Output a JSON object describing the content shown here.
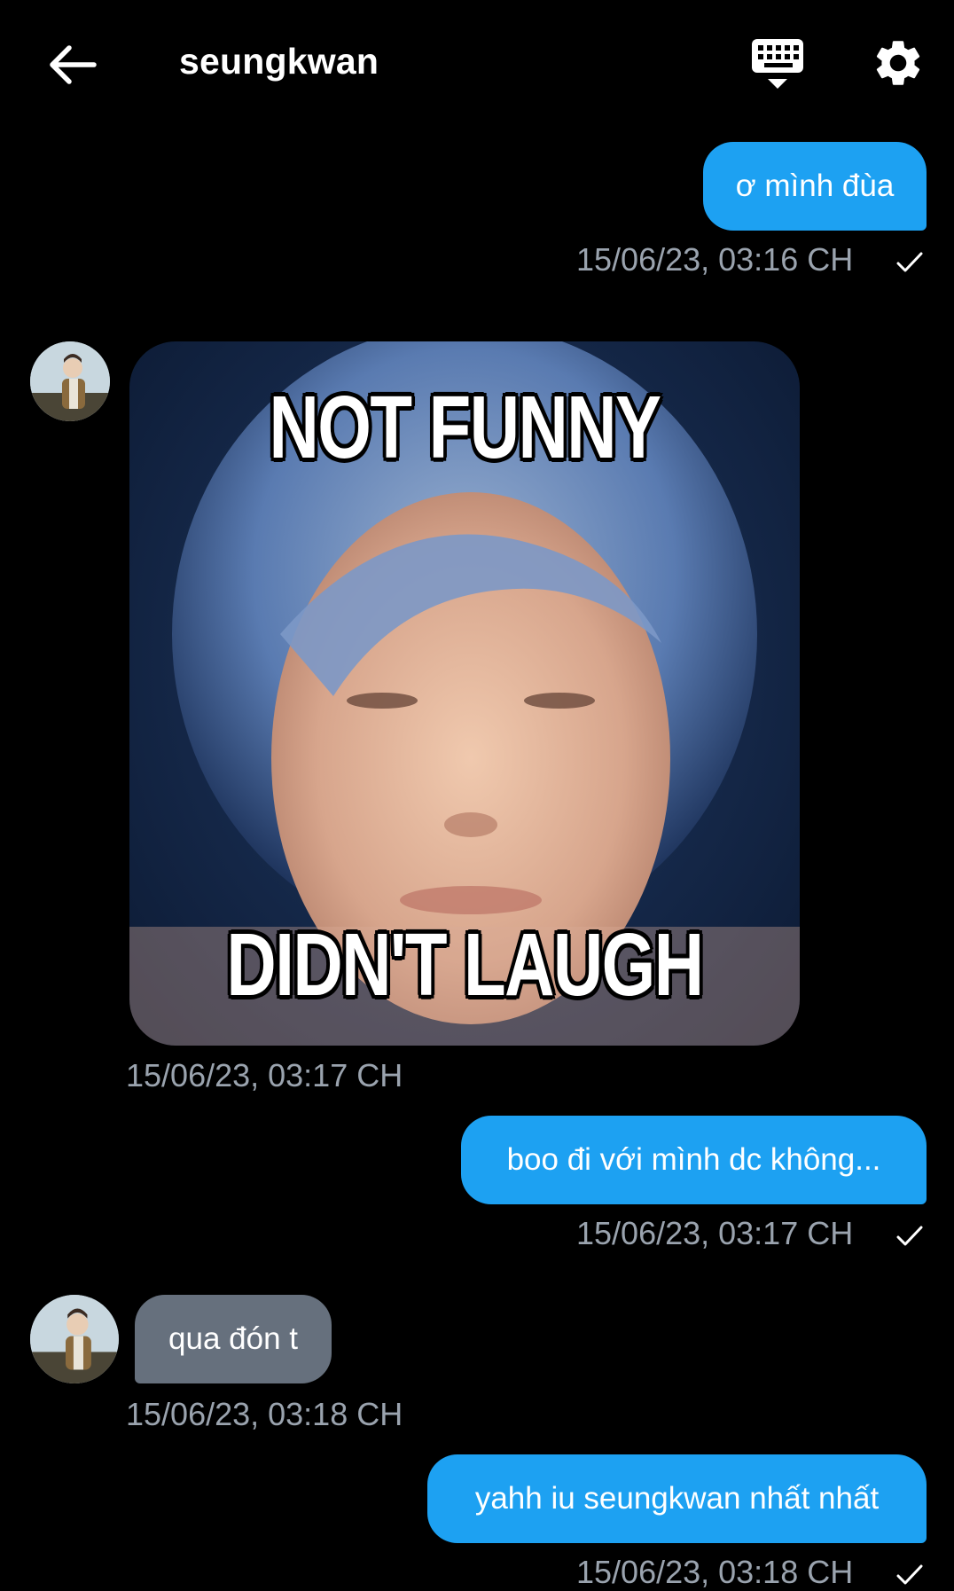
{
  "header": {
    "title": "seungkwan",
    "back_icon": "arrow-left-icon",
    "keyboard_icon": "keyboard-icon",
    "settings_icon": "gear-icon"
  },
  "colors": {
    "background": "#000000",
    "outgoing_bubble": "#1da1f2",
    "incoming_bubble": "#66707d",
    "timestamp": "#9aa3ae"
  },
  "messages": [
    {
      "direction": "outgoing",
      "text": "ơ mình đùa",
      "time": "15/06/23, 03:16 CH",
      "read": true
    },
    {
      "direction": "incoming",
      "type": "image",
      "caption_top": "NOT FUNNY",
      "caption_bottom": "DIDN'T LAUGH",
      "time": "15/06/23, 03:17 CH"
    },
    {
      "direction": "outgoing",
      "text": "boo đi với mình dc không...",
      "time": "15/06/23, 03:17 CH",
      "read": true
    },
    {
      "direction": "incoming",
      "text": "qua đón t",
      "time": "15/06/23, 03:18 CH"
    },
    {
      "direction": "outgoing",
      "text": "yahh iu seungkwan nhất nhất",
      "time": "15/06/23, 03:18 CH",
      "read": true
    }
  ]
}
